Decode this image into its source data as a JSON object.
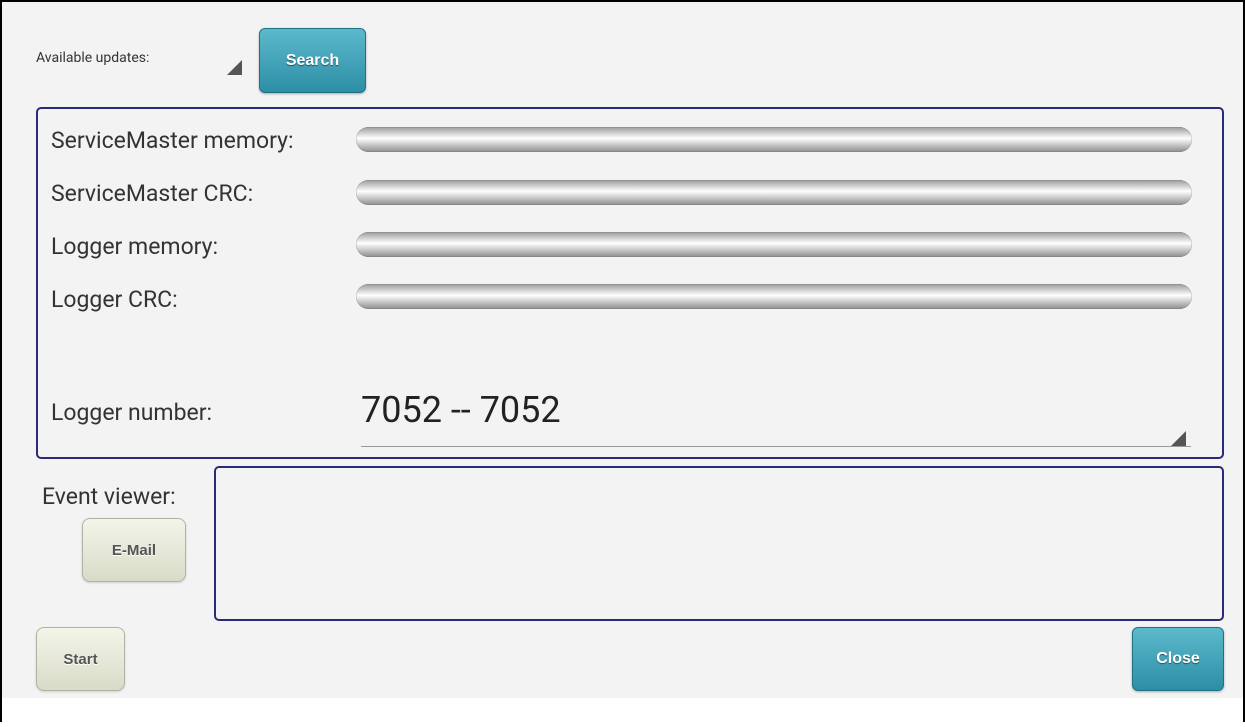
{
  "updates": {
    "label": "Available updates:",
    "search_button": "Search"
  },
  "status_rows": [
    {
      "label": "ServiceMaster memory:",
      "progress": 1.0
    },
    {
      "label": "ServiceMaster CRC:",
      "progress": 1.0
    },
    {
      "label": "Logger memory:",
      "progress": 1.0
    },
    {
      "label": "Logger CRC:",
      "progress": 1.0
    }
  ],
  "logger": {
    "label": "Logger number:",
    "value": "7052 -- 7052"
  },
  "events": {
    "label": "Event viewer:",
    "email_button": "E-Mail",
    "content": ""
  },
  "footer": {
    "start_button": "Start",
    "close_button": "Close"
  },
  "colors": {
    "accent": "#2c8ea5",
    "panel_border": "#2a2a78",
    "background": "#f3f3f3"
  }
}
